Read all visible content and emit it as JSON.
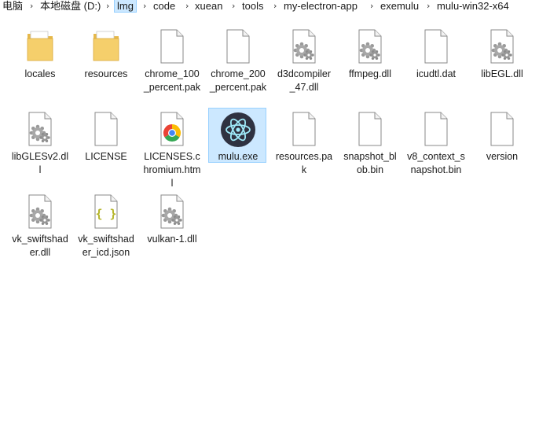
{
  "breadcrumb": {
    "items": [
      "电脑",
      "本地磁盘 (D:)",
      "lmg",
      "code",
      "xuean",
      "tools",
      "my-electron-app",
      "exemulu",
      "mulu-win32-x64"
    ],
    "separator": "›"
  },
  "files": [
    {
      "name": "locales",
      "type": "folder-icon"
    },
    {
      "name": "resources",
      "type": "folder-icon"
    },
    {
      "name": "chrome_100_percent.pak",
      "type": "file-icon"
    },
    {
      "name": "chrome_200_percent.pak",
      "type": "file-icon"
    },
    {
      "name": "d3dcompiler_47.dll",
      "type": "dll-icon"
    },
    {
      "name": "ffmpeg.dll",
      "type": "dll-icon"
    },
    {
      "name": "icudtl.dat",
      "type": "file-icon"
    },
    {
      "name": "libEGL.dll",
      "type": "dll-icon"
    },
    {
      "name": "libGLESv2.dll",
      "type": "dll-icon"
    },
    {
      "name": "LICENSE",
      "type": "file-icon"
    },
    {
      "name": "LICENSES.chromium.html",
      "type": "chrome-icon"
    },
    {
      "name": "mulu.exe",
      "type": "electron-icon",
      "selected": true
    },
    {
      "name": "resources.pak",
      "type": "file-icon"
    },
    {
      "name": "snapshot_blob.bin",
      "type": "file-icon"
    },
    {
      "name": "v8_context_snapshot.bin",
      "type": "file-icon"
    },
    {
      "name": "version",
      "type": "file-icon"
    },
    {
      "name": "vk_swiftshader.dll",
      "type": "dll-icon"
    },
    {
      "name": "vk_swiftshader_icd.json",
      "type": "json-icon"
    },
    {
      "name": "vulkan-1.dll",
      "type": "dll-icon"
    }
  ],
  "colors": {
    "selection_bg": "#cce8ff",
    "selection_border": "#99d1ff",
    "folder": "#f5cf6b",
    "electron_bg": "#2f3241",
    "json_braces": "#b5b52a"
  }
}
